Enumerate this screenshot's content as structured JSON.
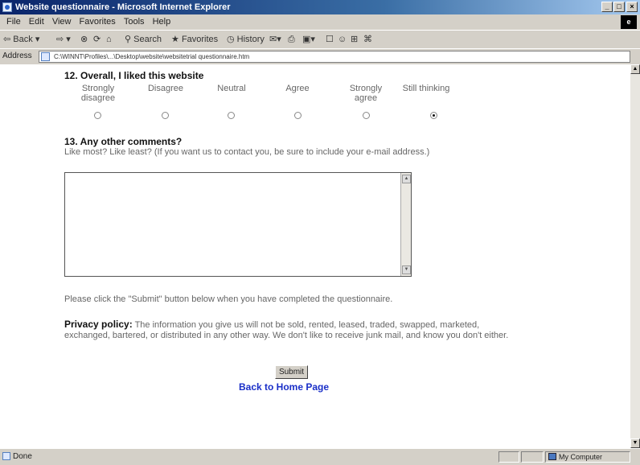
{
  "window": {
    "title": "Website questionnaire - Microsoft Internet Explorer",
    "controls": [
      "_",
      "□",
      "×"
    ]
  },
  "menu": [
    "File",
    "Edit",
    "View",
    "Favorites",
    "Tools",
    "Help"
  ],
  "toolbar": {
    "back": "Back",
    "search": "Search",
    "favorites": "Favorites",
    "history": "History"
  },
  "address": {
    "label": "Address",
    "url": "C:\\WINNT\\Profiles\\...\\Desktop\\website\\websitetrial questionnaire.htm"
  },
  "question12": {
    "title": "12. Overall, I liked this website",
    "options": [
      {
        "label": "Strongly disagree",
        "checked": false
      },
      {
        "label": "Disagree",
        "checked": false
      },
      {
        "label": "Neutral",
        "checked": false
      },
      {
        "label": "Agree",
        "checked": false
      },
      {
        "label": "Strongly agree",
        "checked": false
      },
      {
        "label": "Still thinking",
        "checked": true
      }
    ]
  },
  "question13": {
    "title": "13. Any other comments?",
    "hint": "Like most? Like least? (If you want us to contact you, be sure to include your e-mail address.)",
    "value": ""
  },
  "submit_note": "Please click the \"Submit\" button below when you have completed the questionnaire.",
  "privacy": {
    "label": "Privacy policy:",
    "text": "The information you give us will not be sold, rented, leased, traded, swapped, marketed, exchanged, bartered, or distributed in any other way. We don't like to receive junk mail, and know you don't either."
  },
  "submit_label": "Submit",
  "home_link": "Back to Home Page",
  "status": {
    "text": "Done",
    "zone": "My Computer"
  }
}
